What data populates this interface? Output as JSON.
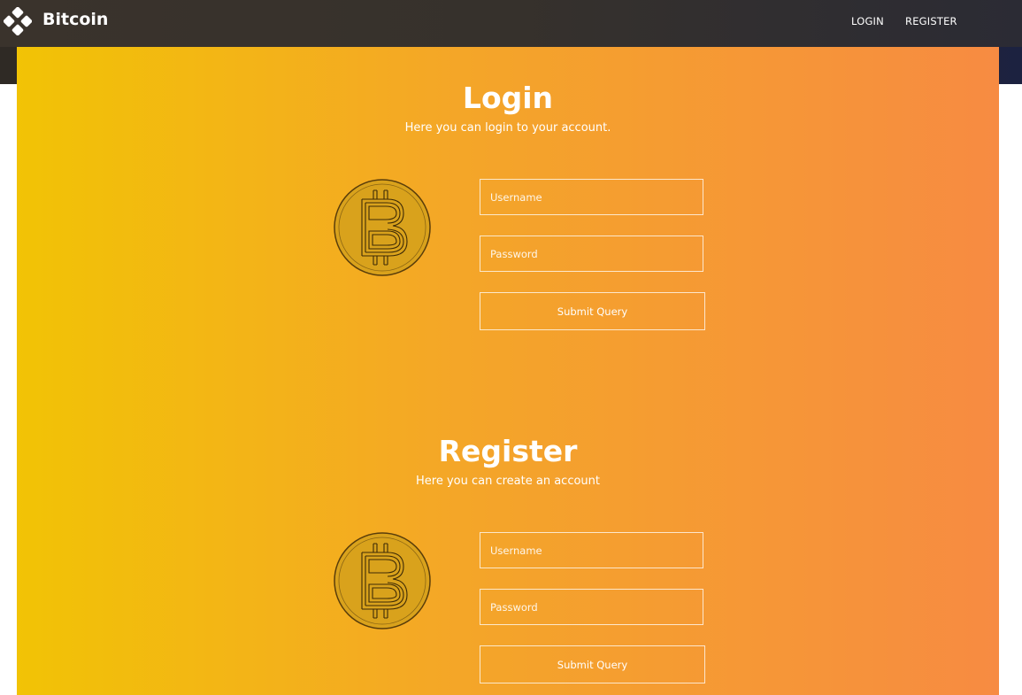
{
  "nav": {
    "brand_name": "Bitcoin",
    "brand_icon": "diamond-cluster-logo-icon",
    "links": [
      "LOGIN",
      "REGISTER"
    ]
  },
  "login": {
    "title": "Login",
    "subtitle": "Here you can login to your account.",
    "coin_icon": "bitcoin-coin-icon",
    "username_placeholder": "Username",
    "password_placeholder": "Password",
    "submit_label": "Submit Query"
  },
  "register": {
    "title": "Register",
    "subtitle": "Here you can create an account",
    "coin_icon": "bitcoin-coin-icon",
    "username_placeholder": "Username",
    "password_placeholder": "Password",
    "submit_label": "Submit Query"
  },
  "colors": {
    "gradient_start": "#f2c305",
    "gradient_end": "#f78b42",
    "navbar": "#36312c",
    "coin_fill": "#d9a21c"
  }
}
